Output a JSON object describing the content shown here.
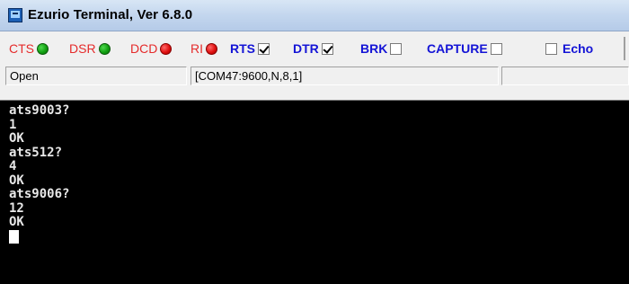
{
  "window": {
    "title": "Ezurio Terminal, Ver 6.8.0"
  },
  "toolbar": {
    "cts": {
      "label": "CTS",
      "state": "green"
    },
    "dsr": {
      "label": "DSR",
      "state": "green"
    },
    "dcd": {
      "label": "DCD",
      "state": "red"
    },
    "ri": {
      "label": "RI",
      "state": "red"
    },
    "rts": {
      "label": "RTS",
      "checked": true
    },
    "dtr": {
      "label": "DTR",
      "checked": true
    },
    "brk": {
      "label": "BRK",
      "checked": false
    },
    "capture": {
      "label": "CAPTURE",
      "checked": false
    },
    "echo": {
      "label": "Echo",
      "checked": false
    }
  },
  "status": {
    "port_state": "Open",
    "port_settings": "[COM47:9600,N,8,1]",
    "extra": ""
  },
  "terminal": {
    "lines": [
      "ats9003?",
      "1",
      "OK",
      "ats512?",
      "4",
      "OK",
      "ats9006?",
      "12",
      "OK"
    ]
  },
  "colors": {
    "signal_label": "#e52b2b",
    "control_label": "#1414d6",
    "led_on": "#11a011",
    "led_off": "#e01010",
    "terminal_bg": "#000000",
    "terminal_fg": "#e8e8e8"
  }
}
